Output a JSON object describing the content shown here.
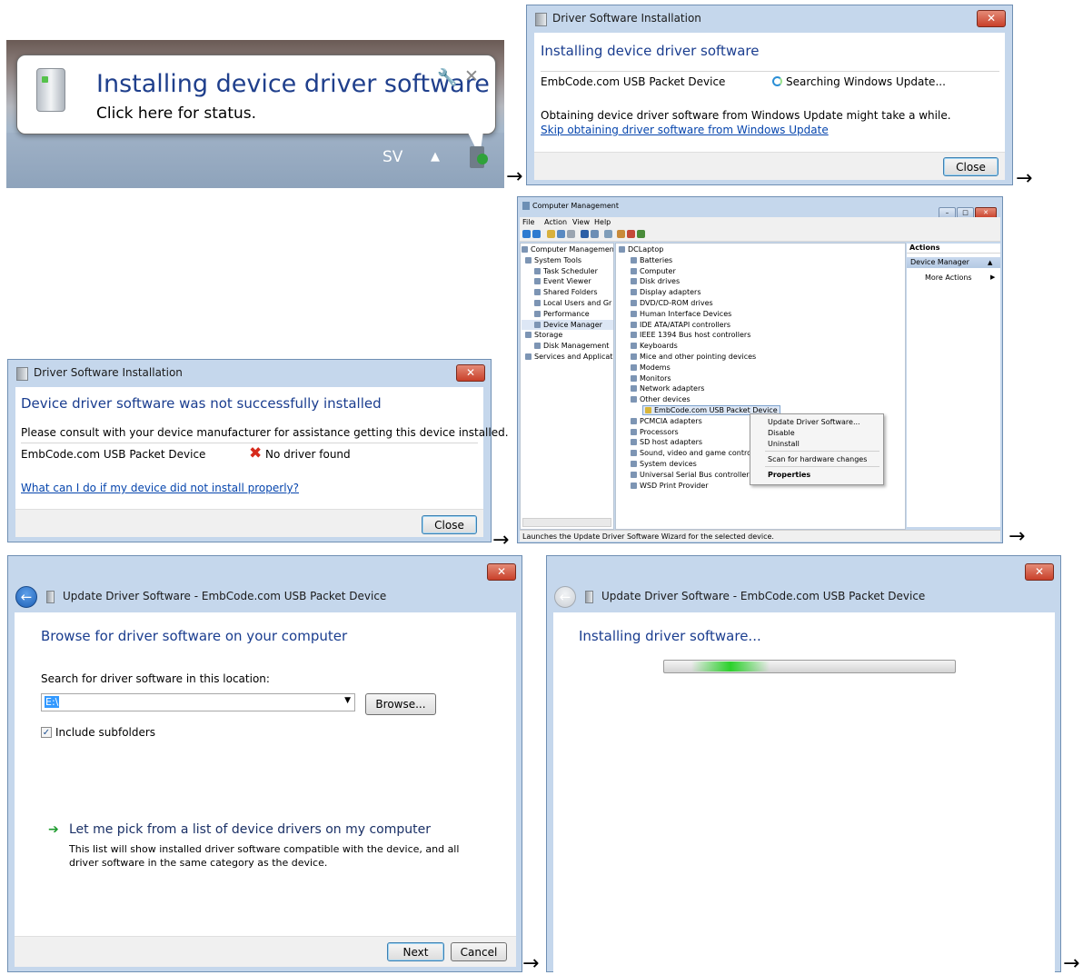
{
  "balloon": {
    "title": "Installing device driver software",
    "subtitle": "Click here for status.",
    "taskbar_lang": "SV",
    "up_arrow": "▲"
  },
  "install_dialog": {
    "title": "Driver Software Installation",
    "heading": "Installing device driver software",
    "device": "EmbCode.com USB Packet Device",
    "status": "Searching Windows Update...",
    "info": "Obtaining device driver software from Windows Update might take a while.",
    "skip_link": "Skip obtaining driver software from Windows Update",
    "close_label": "Close"
  },
  "fail_dialog": {
    "title": "Driver Software Installation",
    "heading": "Device driver software was not successfully installed",
    "info": "Please consult with your device manufacturer for assistance getting this device installed.",
    "device": "EmbCode.com USB Packet Device",
    "status": "No driver found",
    "help_link": "What can I do if my device did not install properly?",
    "close_label": "Close"
  },
  "computer_management": {
    "title": "Computer Management",
    "menu": [
      "File",
      "Action",
      "View",
      "Help"
    ],
    "left_tree": [
      "Computer Management",
      "System Tools",
      "Task Scheduler",
      "Event Viewer",
      "Shared Folders",
      "Local Users and Gr",
      "Performance",
      "Device Manager",
      "Storage",
      "Disk Management",
      "Services and Applicat"
    ],
    "device_tree": [
      "DCLaptop",
      "Batteries",
      "Computer",
      "Disk drives",
      "Display adapters",
      "DVD/CD-ROM drives",
      "Human Interface Devices",
      "IDE ATA/ATAPI controllers",
      "IEEE 1394 Bus host controllers",
      "Keyboards",
      "Mice and other pointing devices",
      "Modems",
      "Monitors",
      "Network adapters",
      "Other devices",
      "EmbCode.com USB Packet Device",
      "PCMCIA adapters",
      "Processors",
      "SD host adapters",
      "Sound, video and game contro",
      "System devices",
      "Universal Serial Bus controllers",
      "WSD Print Provider"
    ],
    "actions_header": "Actions",
    "actions_section": "Device Manager",
    "actions_more": "More Actions",
    "context_menu": [
      "Update Driver Software...",
      "Disable",
      "Uninstall",
      "Scan for hardware changes",
      "Properties"
    ],
    "status_bar": "Launches the Update Driver Software Wizard for the selected device."
  },
  "browse_wizard": {
    "title": "Update Driver Software - EmbCode.com USB Packet Device",
    "heading": "Browse for driver software on your computer",
    "search_label": "Search for driver software in this location:",
    "path_value": "E:\\",
    "browse_label": "Browse...",
    "include_subfolders": "Include subfolders",
    "pick_heading": "Let me pick from a list of device drivers on my computer",
    "pick_desc_1": "This list will show installed driver software compatible with the device, and all",
    "pick_desc_2": "driver software in the same category as the device.",
    "next_label": "Next",
    "cancel_label": "Cancel"
  },
  "installing_wizard": {
    "title": "Update Driver Software - EmbCode.com USB Packet Device",
    "heading": "Installing driver software...",
    "progress_fraction": 0.3
  },
  "arrow_glyph": "→",
  "colors": {
    "heading_blue": "#1a3d8f",
    "link_blue": "#0645ad",
    "frame_blue": "#c5d7ec",
    "close_red": "#c9402a",
    "progress_green": "#2bd12b"
  }
}
